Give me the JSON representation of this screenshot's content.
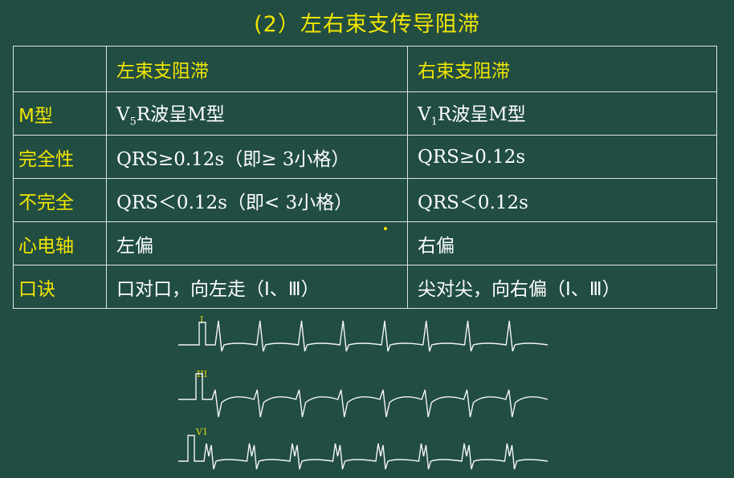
{
  "title": "(2）左右束支传导阻滞",
  "table": {
    "headers": [
      "",
      "左束支阻滞",
      "右束支阻滞"
    ],
    "rows": [
      {
        "label": "M型",
        "left": {
          "lead": "V",
          "sub": "5",
          "rest": "R波呈M型"
        },
        "right": {
          "lead": "V",
          "sub": "1",
          "rest": "R波呈M型"
        }
      },
      {
        "label": "完全性",
        "left": "QRS≥0.12s（即≥ 3小格）",
        "right": "QRS≥0.12s"
      },
      {
        "label": "不完全",
        "left": "QRS＜0.12s（即< 3小格）",
        "right": "QRS＜0.12s"
      },
      {
        "label": "心电轴",
        "left": "左偏",
        "right": "右偏"
      },
      {
        "label": "口诀",
        "left": "口对口，向左走（Ⅰ、Ⅲ）",
        "right": "尖对尖，向右偏（Ⅰ、Ⅲ）"
      }
    ]
  },
  "ecg": {
    "leads": [
      "I",
      "III",
      "V1"
    ],
    "beats_per_strip": 8
  }
}
